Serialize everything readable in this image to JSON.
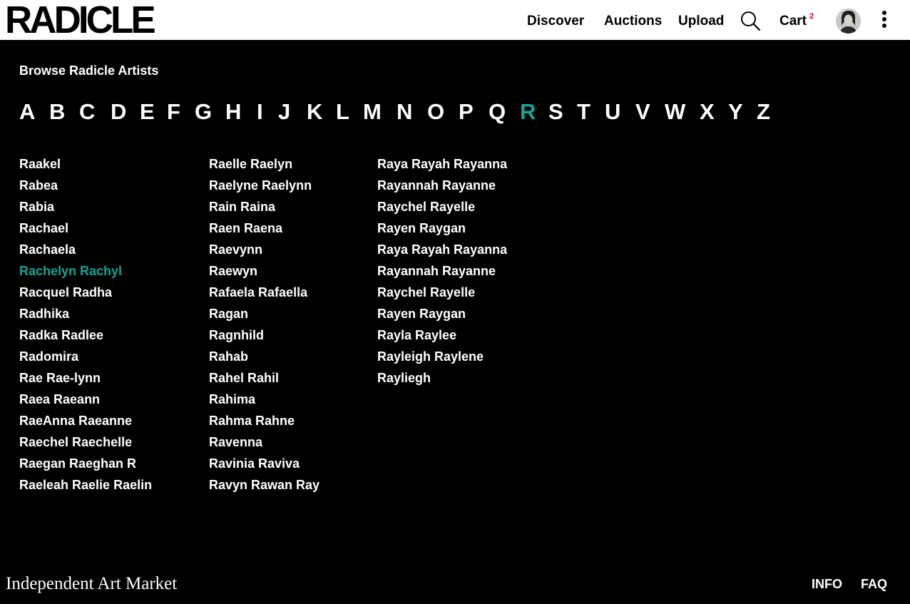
{
  "header": {
    "logo": "RADICLE",
    "nav": {
      "discover": "Discover",
      "auctions": "Auctions",
      "upload": "Upload",
      "cart": "Cart",
      "cart_count": "2"
    },
    "icons": {
      "search": "search-icon",
      "menu": "more-vertical-icon",
      "avatar": "user-avatar"
    }
  },
  "main": {
    "heading": "Browse Radicle Artists",
    "letters": [
      "A",
      "B",
      "C",
      "D",
      "E",
      "F",
      "G",
      "H",
      "I",
      "J",
      "K",
      "L",
      "M",
      "N",
      "O",
      "P",
      "Q",
      "R",
      "S",
      "T",
      "U",
      "V",
      "W",
      "X",
      "Y",
      "Z"
    ],
    "active_letter": "R",
    "columns": [
      [
        "Raakel",
        "Rabea",
        "Rabia",
        "Rachael",
        "Rachaela",
        "Rachelyn Rachyl",
        "Racquel Radha",
        "Radhika",
        "Radka Radlee",
        "Radomira",
        "Rae Rae-lynn",
        "Raea Raeann",
        "RaeAnna Raeanne",
        "Raechel Raechelle",
        "Raegan Raeghan R",
        "Raeleah Raelie Raelin"
      ],
      [
        "Raelle Raelyn",
        "Raelyne Raelynn",
        "Rain Raina",
        "Raen Raena",
        "Raevynn",
        "Raewyn",
        "Rafaela Rafaella",
        "Ragan",
        "Ragnhild",
        "Rahab",
        "Rahel Rahil",
        "Rahima",
        "Rahma Rahne",
        "Ravenna",
        "Ravinia Raviva",
        "Ravyn Rawan Ray"
      ],
      [
        "Raya Rayah Rayanna",
        "Rayannah Rayanne",
        "Raychel Rayelle",
        "Rayen Raygan",
        "Raya Rayah Rayanna",
        "Rayannah Rayanne",
        "Raychel Rayelle",
        "Rayen Raygan",
        "Rayla Raylee",
        "Rayleigh Raylene",
        "Rayliegh"
      ]
    ],
    "active_name": "Rachelyn Rachyl",
    "accent_color": "#16a393"
  },
  "footer": {
    "tagline": "Independent Art Market",
    "info": "INFO",
    "faq": "FAQ"
  }
}
